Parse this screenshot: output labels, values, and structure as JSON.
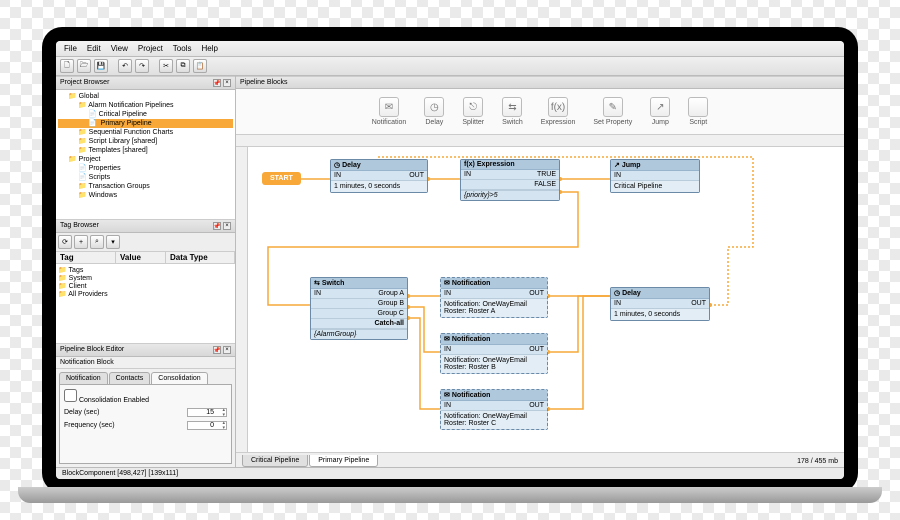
{
  "menu": [
    "File",
    "Edit",
    "View",
    "Project",
    "Tools",
    "Help"
  ],
  "project_browser": {
    "title": "Project Browser",
    "tree": [
      {
        "l": "Global",
        "c": "folder indent1"
      },
      {
        "l": "Alarm Notification Pipelines",
        "c": "folder indent2"
      },
      {
        "l": "Critical Pipeline",
        "c": "doc indent3"
      },
      {
        "l": "Primary Pipeline",
        "c": "doc indent3 sel"
      },
      {
        "l": "Sequential Function Charts",
        "c": "folder indent2"
      },
      {
        "l": "Script Library [shared]",
        "c": "folder indent2"
      },
      {
        "l": "Templates [shared]",
        "c": "folder indent2"
      },
      {
        "l": "Project",
        "c": "folder indent1"
      },
      {
        "l": "Properties",
        "c": "doc indent2"
      },
      {
        "l": "Scripts",
        "c": "doc indent2"
      },
      {
        "l": "Transaction Groups",
        "c": "folder indent2"
      },
      {
        "l": "Windows",
        "c": "folder indent2"
      }
    ]
  },
  "tag_browser": {
    "title": "Tag Browser",
    "columns": [
      "Tag",
      "Value",
      "Data Type"
    ],
    "tree": [
      "Tags",
      "System",
      "Client",
      "All Providers"
    ]
  },
  "block_editor": {
    "title": "Pipeline Block Editor",
    "subtitle": "Notification Block",
    "tabs": [
      "Notification",
      "Contacts",
      "Consolidation"
    ],
    "active_tab": 2,
    "checkbox": "Consolidation Enabled",
    "delay_label": "Delay (sec)",
    "delay_value": "15",
    "freq_label": "Frequency (sec)",
    "freq_value": "0"
  },
  "pipeline_blocks": {
    "title": "Pipeline Blocks",
    "palette": [
      {
        "icon": "✉",
        "label": "Notification"
      },
      {
        "icon": "◷",
        "label": "Delay"
      },
      {
        "icon": "⎋",
        "label": "Splitter"
      },
      {
        "icon": "⇆",
        "label": "Switch"
      },
      {
        "icon": "f(x)",
        "label": "Expression"
      },
      {
        "icon": "✎",
        "label": "Set Property"
      },
      {
        "icon": "↗",
        "label": "Jump"
      },
      {
        "icon": "</>",
        "label": "Script"
      }
    ]
  },
  "canvas": {
    "start": "START",
    "delay1": {
      "title": "Delay",
      "in": "IN",
      "out": "OUT",
      "body": "1 minutes, 0 seconds"
    },
    "expr": {
      "title": "Expression",
      "in": "IN",
      "t": "TRUE",
      "f": "FALSE",
      "body": "{priority}>5"
    },
    "jump": {
      "title": "Jump",
      "in": "IN",
      "body": "Critical Pipeline"
    },
    "switch": {
      "title": "Switch",
      "in": "IN",
      "opts": [
        "Group A",
        "Group B",
        "Group C",
        "Catch-all"
      ],
      "sub": "{AlarmGroup}"
    },
    "notif1": {
      "title": "Notification",
      "in": "IN",
      "out": "OUT",
      "l1": "Notification: OneWayEmail",
      "l2": "Roster: Roster A"
    },
    "notif2": {
      "title": "Notification",
      "in": "IN",
      "out": "OUT",
      "l1": "Notification: OneWayEmail",
      "l2": "Roster: Roster B"
    },
    "notif3": {
      "title": "Notification",
      "in": "IN",
      "out": "OUT",
      "l1": "Notification: OneWayEmail",
      "l2": "Roster: Roster C"
    },
    "delay2": {
      "title": "Delay",
      "in": "IN",
      "out": "OUT",
      "body": "1 minutes, 0 seconds"
    },
    "tabs": [
      "Critical Pipeline",
      "Primary Pipeline"
    ],
    "mem": "178 / 455 mb"
  },
  "status": {
    "left": "BlockComponent [498,427] [139x111]"
  }
}
